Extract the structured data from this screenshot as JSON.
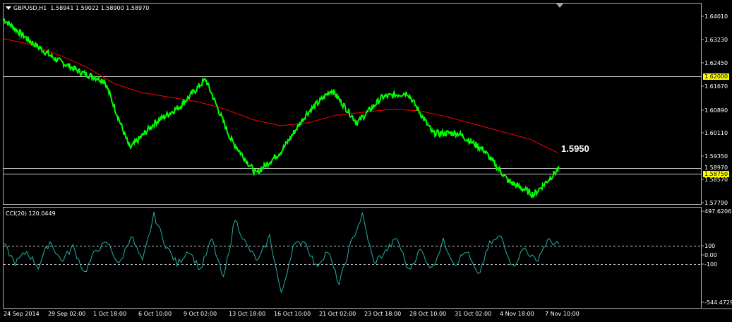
{
  "main_header": {
    "symbol": "GBPUSD,H1",
    "ohlc": "1.58941 1.59022 1.58900 1.58970"
  },
  "indicator_header": {
    "name": "CCI(20)",
    "value": "120.0449"
  },
  "annotation": "1.5950",
  "price_axis": {
    "ticks": [
      "1.64010",
      "1.63230",
      "1.62450",
      "1.61670",
      "1.60890",
      "1.60110",
      "1.59350",
      "1.58570",
      "1.57790"
    ],
    "highlight_upper": "1.62000",
    "highlight_lower": "1.58750",
    "current": "1.58970"
  },
  "cci_axis": {
    "ticks": [
      "497.6206",
      "100",
      "0.00",
      "-100",
      "-544.4729"
    ]
  },
  "time_axis": [
    "24 Sep 2014",
    "29 Sep 02:00",
    "1 Oct 18:00",
    "6 Oct 10:00",
    "9 Oct 02:00",
    "13 Oct 18:00",
    "16 Oct 10:00",
    "21 Oct 02:00",
    "23 Oct 18:00",
    "28 Oct 10:00",
    "31 Oct 02:00",
    "4 Nov 18:00",
    "7 Nov 10:00"
  ],
  "colors": {
    "background": "#000000",
    "price": "#00ff00",
    "moving_average": "#ff0000",
    "cci": "#20b2aa",
    "highlight": "#ffff00"
  },
  "chart_data": [
    {
      "type": "line",
      "title": "GBPUSD,H1",
      "x": [
        "24 Sep 2014",
        "29 Sep 02:00",
        "1 Oct 18:00",
        "6 Oct 10:00",
        "9 Oct 02:00",
        "13 Oct 18:00",
        "16 Oct 10:00",
        "21 Oct 02:00",
        "23 Oct 18:00",
        "28 Oct 10:00",
        "31 Oct 02:00",
        "4 Nov 18:00",
        "7 Nov 10:00"
      ],
      "ylim": [
        1.5779,
        1.6447
      ],
      "series": [
        {
          "values": [
            1.6395,
            1.6325,
            1.6265,
            1.622,
            1.619,
            1.5965,
            1.605,
            1.6105,
            1.6195,
            1.5995,
            1.588,
            1.5955,
            1.608,
            1.616,
            1.605,
            1.6135,
            1.615,
            1.6015,
            1.6015,
            1.596,
            1.5855,
            1.581,
            1.5897
          ]
        },
        {
          "values": [
            1.633,
            1.631,
            1.6275,
            1.6235,
            1.618,
            1.615,
            1.6135,
            1.612,
            1.6095,
            1.606,
            1.604,
            1.605,
            1.6075,
            1.6085,
            1.6095,
            1.609,
            1.607,
            1.6045,
            1.602,
            1.5995,
            1.595
          ]
        }
      ],
      "annotations": [
        "1.5950"
      ],
      "hlines": [
        1.62,
        1.5875,
        1.5897
      ]
    },
    {
      "type": "line",
      "title": "CCI(20)",
      "ylim": [
        -544.4729,
        497.6206
      ],
      "hlines": [
        100,
        -100
      ],
      "series": [
        {
          "name": "CCI(20)",
          "values": [
            120,
            -80,
            40,
            -120,
            150,
            -60,
            90,
            -180,
            60,
            130,
            -100,
            210,
            -70,
            420,
            110,
            -90,
            60,
            -150,
            170,
            -250,
            380,
            100,
            -60,
            200,
            -410,
            90,
            160,
            -120,
            50,
            -300,
            120,
            420,
            -80,
            40,
            180,
            -160,
            60,
            -140,
            150,
            -90,
            50,
            -220,
            120,
            200,
            -120,
            80,
            -60,
            150,
            120
          ]
        }
      ]
    }
  ]
}
